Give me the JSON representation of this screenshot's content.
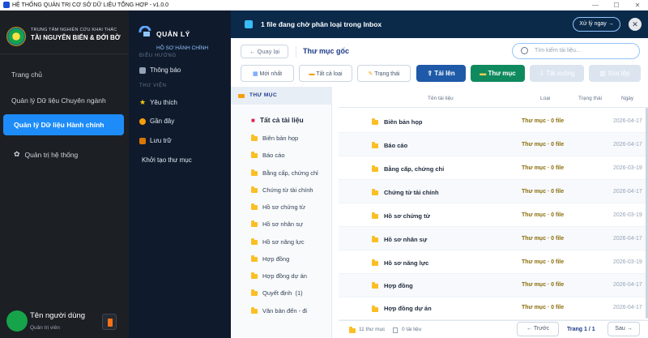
{
  "window": {
    "title": "HỆ THỐNG QUẢN TRỊ CƠ SỞ DỮ LIỆU TỔNG HỢP - v1.0.0"
  },
  "sidebar": {
    "org_line1": "TRUNG TÂM NGHIÊN CỨU KHAI THÁC",
    "org_line2": "TÀI NGUYÊN BIỂN & ĐỚI BỜ",
    "items": [
      {
        "label": "Trang chủ"
      },
      {
        "label": "Quản lý Dữ liệu Chuyên ngành"
      },
      {
        "label": "Quản lý Dữ liệu Hành chính",
        "active": true
      },
      {
        "label": "Quản trị hệ thống"
      }
    ],
    "user": {
      "name": "Tên người dùng",
      "role": "Quản trị viên"
    }
  },
  "subnav": {
    "title": "QUẢN LÝ",
    "subtitle": "HỒ SƠ HÀNH CHÍNH",
    "section_nav": "ĐIỀU HƯỚNG",
    "notify": "Thông báo",
    "section_lib": "THƯ VIỆN",
    "fav": "Yêu thích",
    "recent": "Gần đây",
    "archive": "Lưu trữ",
    "init": "Khởi tạo thư mục"
  },
  "header": {
    "notice": "1 file đang chờ phân loại trong Inbox",
    "process_btn": "Xử lý ngay →",
    "close": "✕"
  },
  "toolbar": {
    "back": "← Quay lại",
    "breadcrumb": "Thư mục gốc",
    "search_placeholder": "Tìm kiếm tài liệu...",
    "newest": "Mới nhất",
    "all_types": "Tất cả loại",
    "status": "Trạng thái",
    "upload": "Tải lên",
    "folder": "Thư mục",
    "download": "Tải xuống",
    "delete": "Xóa tệp"
  },
  "tree": {
    "header": "THƯ MỤC",
    "all": "Tất cả tài liệu",
    "items": [
      "Biên bản họp",
      "Báo cáo",
      "Bằng cấp, chứng chỉ",
      "Chứng từ tài chính",
      "Hồ sơ chứng từ",
      "Hồ sơ nhân sự",
      "Hồ sơ năng lực",
      "Hợp đồng",
      "Hợp đồng dự án",
      "Quyết định  (1)",
      "Văn bản đến - đi"
    ]
  },
  "table": {
    "headers": {
      "name": "Tên tài liệu",
      "type": "Loại",
      "status": "Trạng thái",
      "date": "Ngày"
    },
    "rows": [
      {
        "name": "Biên bản họp",
        "type": "Thư mục · 0 file",
        "date": "2026-04-17"
      },
      {
        "name": "Báo cáo",
        "type": "Thư mục · 0 file",
        "date": "2026-04-17"
      },
      {
        "name": "Bằng cấp, chứng chỉ",
        "type": "Thư mục · 0 file",
        "date": "2026-03-19"
      },
      {
        "name": "Chứng từ tài chính",
        "type": "Thư mục · 0 file",
        "date": "2026-04-17"
      },
      {
        "name": "Hồ sơ chứng từ",
        "type": "Thư mục · 0 file",
        "date": "2026-03-19"
      },
      {
        "name": "Hồ sơ nhân sự",
        "type": "Thư mục · 0 file",
        "date": "2026-04-17"
      },
      {
        "name": "Hồ sơ năng lực",
        "type": "Thư mục · 0 file",
        "date": "2026-03-19"
      },
      {
        "name": "Hợp đồng",
        "type": "Thư mục · 0 file",
        "date": "2026-04-17"
      },
      {
        "name": "Hợp đồng dự án",
        "type": "Thư mục · 0 file",
        "date": "2026-04-17"
      }
    ]
  },
  "footer": {
    "folders": "11 thư mục",
    "files": "0 tài liệu",
    "prev": "← Trước",
    "page": "Trang 1 / 1",
    "next": "Sau →"
  }
}
